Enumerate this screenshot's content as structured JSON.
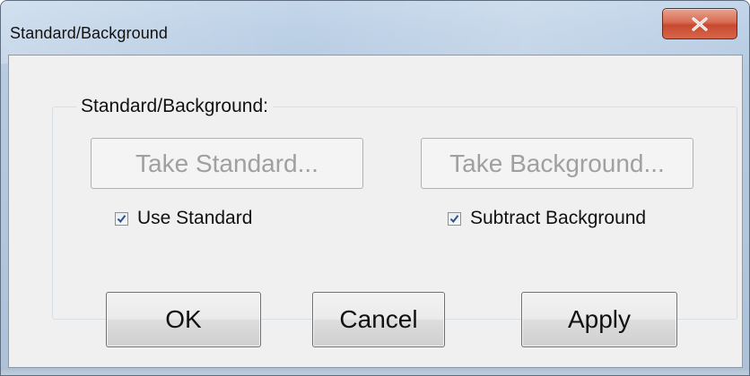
{
  "window": {
    "title": "Standard/Background",
    "close_icon": "close-icon"
  },
  "group": {
    "label": "Standard/Background:",
    "take_standard_label": "Take Standard...",
    "take_background_label": "Take Background...",
    "use_standard": {
      "label": "Use Standard",
      "checked": true
    },
    "subtract_background": {
      "label": "Subtract Background",
      "checked": true
    }
  },
  "footer": {
    "ok_label": "OK",
    "cancel_label": "Cancel",
    "apply_label": "Apply"
  },
  "colors": {
    "close_button": "#c74a2f",
    "title_bar": "#bcd0e6",
    "client_background": "#f0f0f0",
    "checkmark": "#2c4f8c"
  }
}
